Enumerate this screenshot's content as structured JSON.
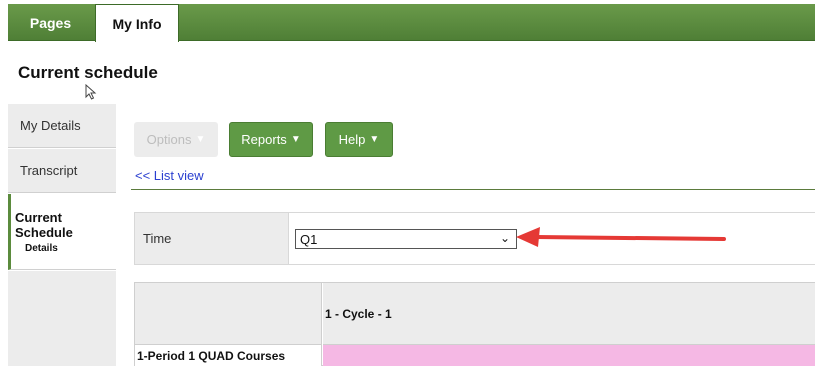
{
  "tabs": [
    {
      "label": "Pages"
    },
    {
      "label": "My Info",
      "active": true
    }
  ],
  "page": {
    "title": "Current schedule"
  },
  "sidebar": {
    "items": [
      {
        "label": "My Details"
      },
      {
        "label": "Transcript"
      },
      {
        "label": "Current Schedule",
        "sublabel": "Details",
        "active": true
      }
    ]
  },
  "toolbar": {
    "options_label": "Options",
    "reports_label": "Reports",
    "help_label": "Help",
    "list_view_link": "<< List view"
  },
  "filter": {
    "label": "Time",
    "selected": "Q1"
  },
  "schedule": {
    "column_header": "1 - Cycle - 1",
    "rows": [
      {
        "label": "1-Period 1 QUAD Courses"
      }
    ]
  },
  "colors": {
    "accent_green": "#5f9a45",
    "course_cell": "#f5b8e4",
    "annotation_arrow": "#e53935"
  }
}
